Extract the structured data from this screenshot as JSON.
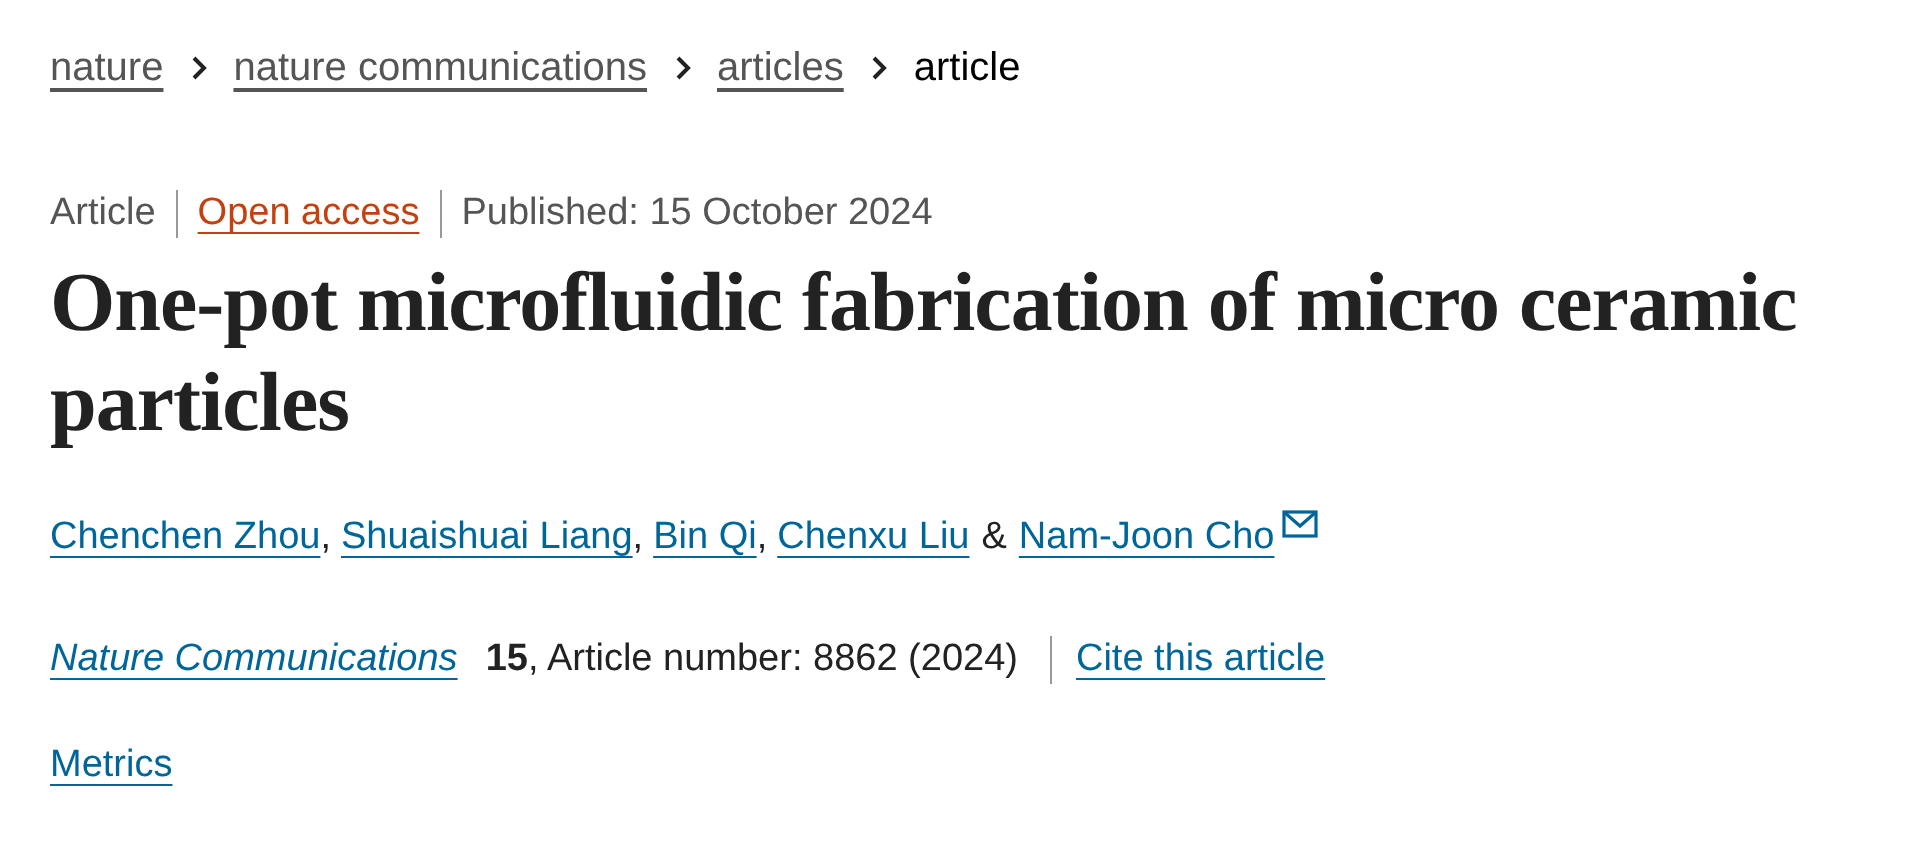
{
  "breadcrumb": [
    {
      "label": "nature",
      "kind": "link"
    },
    {
      "label": "nature communications",
      "kind": "link"
    },
    {
      "label": "articles",
      "kind": "link"
    },
    {
      "label": "article",
      "kind": "current"
    }
  ],
  "meta": {
    "type": "Article",
    "access": "Open access",
    "published": "Published: 15 October 2024"
  },
  "title": "One-pot microfluidic fabrication of micro ceramic particles",
  "authors": [
    {
      "name": "Chenchen Zhou",
      "separator": ","
    },
    {
      "name": "Shuaishuai Liang",
      "separator": ","
    },
    {
      "name": "Bin Qi",
      "separator": ","
    },
    {
      "name": "Chenxu Liu",
      "separator": "&"
    },
    {
      "name": "Nam-Joon Cho",
      "corresponding": true
    }
  ],
  "citation": {
    "journal": "Nature Communications",
    "volume": "15",
    "article_number": ", Article number: 8862 (2024)",
    "cite_link": "Cite this article"
  },
  "metrics_link": "Metrics"
}
